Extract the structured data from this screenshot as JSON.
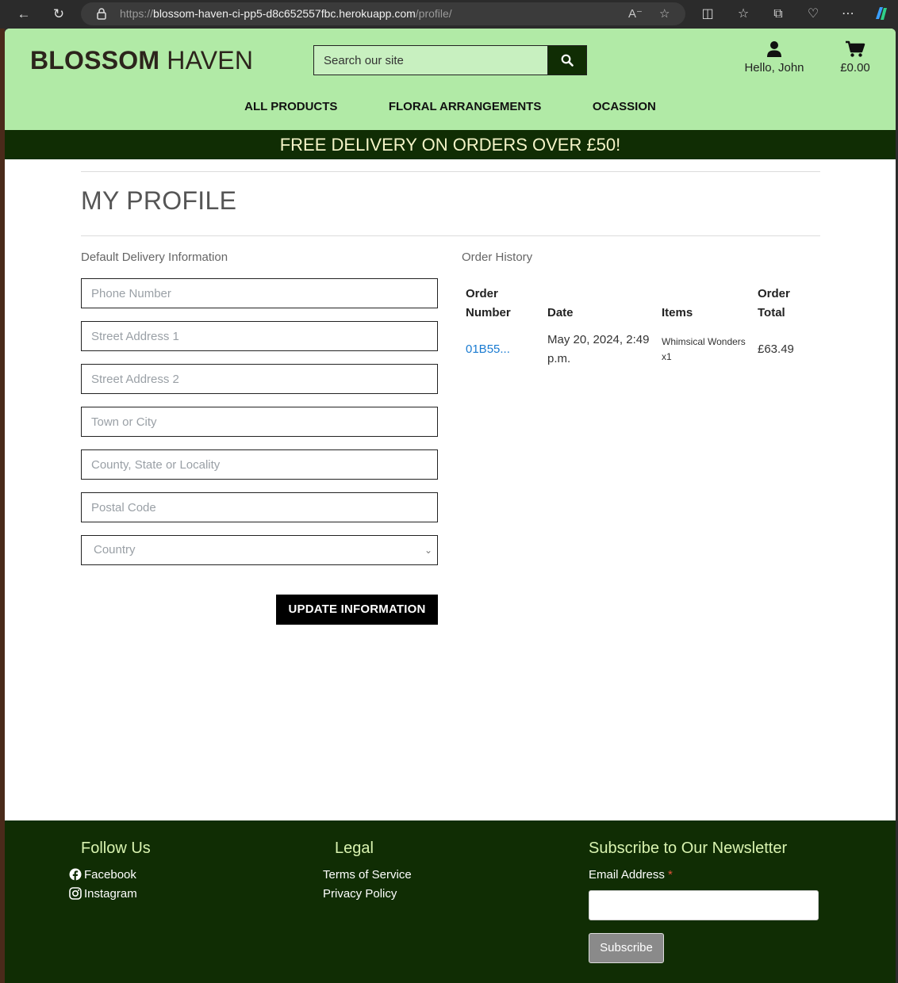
{
  "browser": {
    "url_prefix": "https://",
    "url_host": "blossom-haven-ci-pp5-d8c652557fbc.herokuapp.com",
    "url_path": "/profile/"
  },
  "header": {
    "brand_bold": "BLOSSOM",
    "brand_rest": " HAVEN",
    "search_placeholder": "Search our site",
    "account_label": "Hello, John",
    "bag_total": "£0.00",
    "nav": [
      "ALL PRODUCTS",
      "FLORAL ARRANGEMENTS",
      "OCASSION"
    ],
    "banner": "FREE DELIVERY ON ORDERS OVER £50!"
  },
  "profile": {
    "title": "MY PROFILE",
    "delivery_heading": "Default Delivery Information",
    "fields": {
      "phone": "Phone Number",
      "street1": "Street Address 1",
      "street2": "Street Address 2",
      "town": "Town or City",
      "county": "County, State or Locality",
      "postcode": "Postal Code"
    },
    "country_placeholder": "Country",
    "update_button": "UPDATE INFORMATION",
    "history_heading": "Order History",
    "table_headers": {
      "number": "Order Number",
      "date": "Date",
      "items": "Items",
      "total": "Order Total"
    },
    "orders": [
      {
        "number": "01B55...",
        "date": "May 20, 2024, 2:49 p.m.",
        "items": "Whimsical Wonders x1",
        "total": "£63.49"
      }
    ]
  },
  "footer": {
    "follow_heading": "Follow Us",
    "facebook": "Facebook",
    "instagram": "Instagram",
    "legal_heading": "Legal",
    "terms": "Terms of Service",
    "privacy": "Privacy Policy",
    "newsletter_heading": "Subscribe to Our Newsletter",
    "email_label": "Email Address",
    "required_mark": "*",
    "subscribe_button": "Subscribe"
  },
  "colors": {
    "header_bg": "#b1eaa6",
    "dark_green": "#102d04",
    "link_blue": "#1a7bd1"
  }
}
